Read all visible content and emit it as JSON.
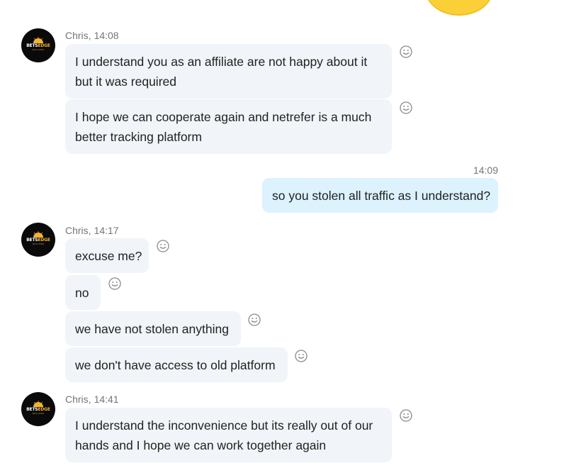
{
  "conversation": {
    "groups": [
      {
        "sender": "Chris",
        "time": "14:08",
        "messages": [
          {
            "lines": [
              "I understand you as an affiliate are not happy about it",
              "but it was required"
            ]
          },
          {
            "lines": [
              "I hope we can cooperate again and netrefer is a much",
              "better tracking platform"
            ]
          }
        ]
      },
      {
        "time": "14:09",
        "outgoing": true,
        "messages": [
          {
            "lines": [
              "so you stolen all traffic as I understand?"
            ]
          }
        ]
      },
      {
        "sender": "Chris",
        "time": "14:17",
        "messages": [
          {
            "lines": [
              "excuse me?"
            ]
          },
          {
            "lines": [
              "no"
            ]
          },
          {
            "lines": [
              "we have not stolen anything"
            ]
          },
          {
            "lines": [
              "we don't have access to old platform"
            ]
          }
        ]
      },
      {
        "sender": "Chris",
        "time": "14:41",
        "messages": [
          {
            "lines": [
              "I understand the inconvenience but its really out of our",
              "hands and I hope we can work together again"
            ]
          }
        ]
      }
    ]
  },
  "avatar": {
    "logo_main_left": "BETS",
    "logo_main_right": "EDGE",
    "logo_sub": "AFFILIATES"
  },
  "colors": {
    "incoming_bubble": "#f1f4f8",
    "outgoing_bubble": "#dcf2fd",
    "timestamp": "#757575",
    "text": "#222222",
    "brand_accent": "#f2b233"
  },
  "icons": {
    "reaction": "smiley-icon",
    "sticker": "yellow-emoji"
  }
}
